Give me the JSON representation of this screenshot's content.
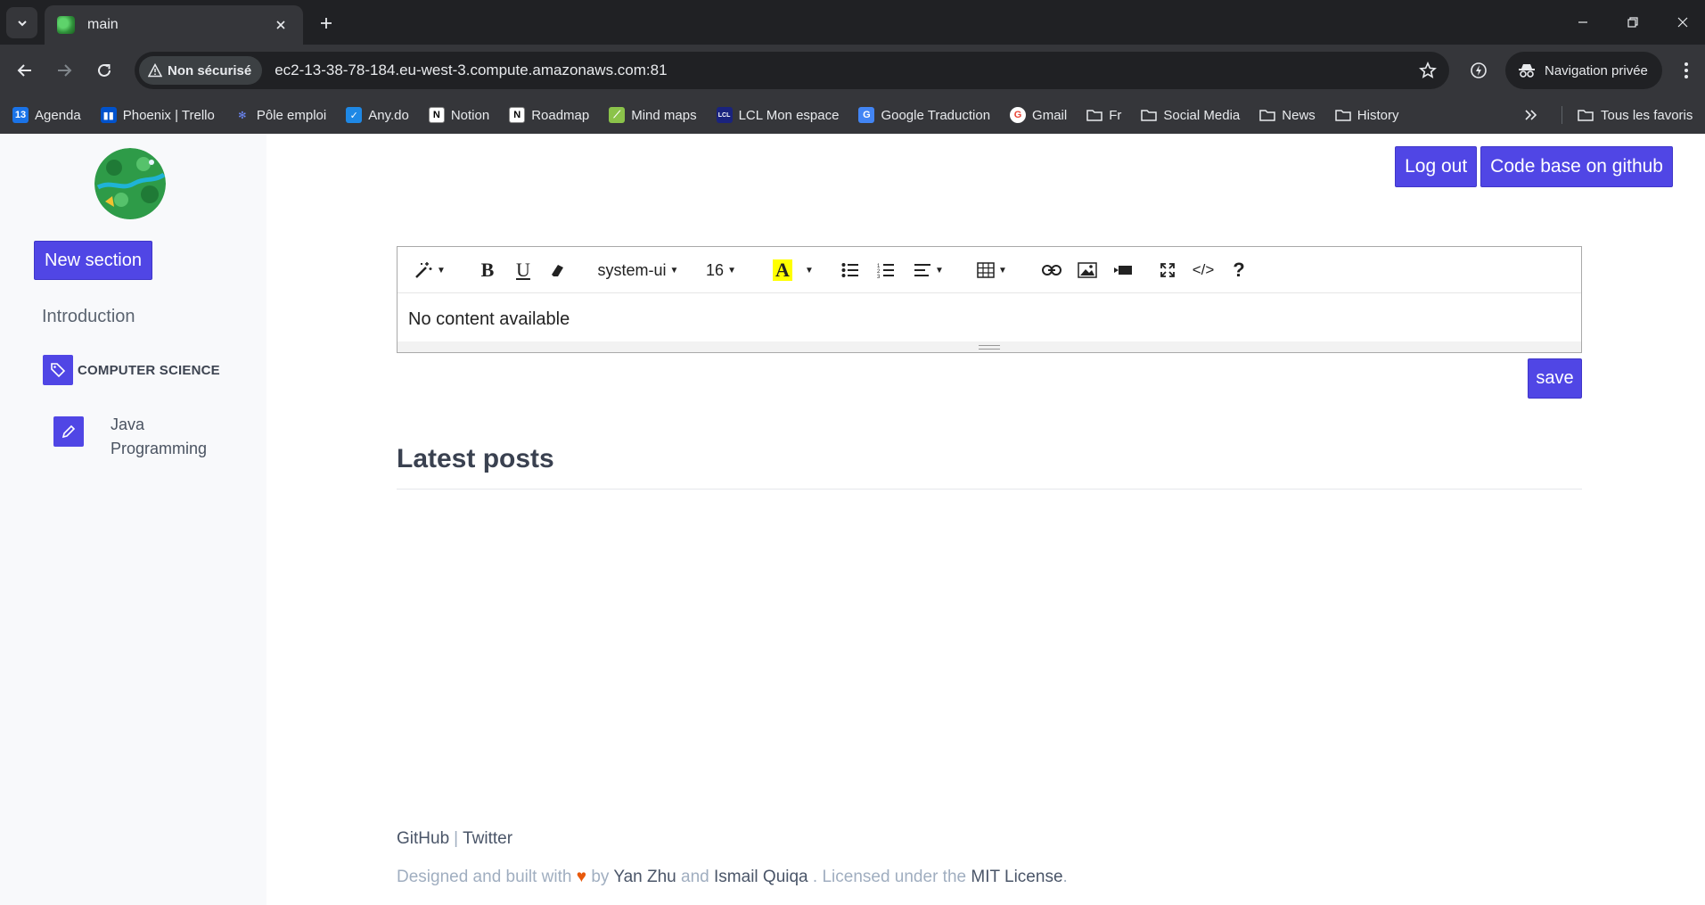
{
  "browser": {
    "tab_title": "main",
    "security_label": "Non sécurisé",
    "url": "ec2-13-38-78-184.eu-west-3.compute.amazonaws.com:81",
    "incognito_label": "Navigation privée",
    "all_bookmarks_label": "Tous les favoris",
    "bookmarks": [
      {
        "label": "Agenda",
        "icon": "calendar-icon",
        "color": "#1a73e8"
      },
      {
        "label": "Phoenix | Trello",
        "icon": "trello-icon",
        "color": "#0052cc"
      },
      {
        "label": "Pôle emploi",
        "icon": "pole-emploi-icon",
        "color": "#3d5afe"
      },
      {
        "label": "Any.do",
        "icon": "anydo-icon",
        "color": "#1e88e5"
      },
      {
        "label": "Notion",
        "icon": "notion-icon",
        "color": "#ffffff"
      },
      {
        "label": "Roadmap",
        "icon": "notion-icon",
        "color": "#ffffff"
      },
      {
        "label": "Mind maps",
        "icon": "mindmap-icon",
        "color": "#8bc34a"
      },
      {
        "label": "LCL Mon espace",
        "icon": "lcl-icon",
        "color": "#1a237e"
      },
      {
        "label": "Google Traduction",
        "icon": "translate-icon",
        "color": "#4285f4"
      },
      {
        "label": "Gmail",
        "icon": "google-icon",
        "color": "#ffffff"
      },
      {
        "label": "Fr",
        "icon": "folder-icon",
        "color": ""
      },
      {
        "label": "Social Media",
        "icon": "folder-icon",
        "color": ""
      },
      {
        "label": "News",
        "icon": "folder-icon",
        "color": ""
      },
      {
        "label": "History",
        "icon": "folder-icon",
        "color": ""
      }
    ]
  },
  "sidebar": {
    "new_section_label": "New section",
    "intro_label": "Introduction",
    "section_label": "COMPUTER SCIENCE",
    "sub_item_label": "Java Programming"
  },
  "header": {
    "logout_label": "Log out",
    "github_label": "Code base on github"
  },
  "editor": {
    "font_family": "system-ui",
    "font_size": "16",
    "content": "No content available",
    "save_label": "save"
  },
  "main": {
    "latest_posts_title": "Latest posts"
  },
  "footer": {
    "github": "GitHub",
    "separator": "|",
    "twitter": "Twitter",
    "designed_prefix": "Designed and built with",
    "heart": "♥",
    "by": "by",
    "author1": "Yan Zhu",
    "and": "and",
    "author2": "Ismail Quiqa",
    "licensed_prefix": ". Licensed under the",
    "license": "MIT License",
    "period": "."
  },
  "colors": {
    "accent": "#5046e5",
    "sidebar_bg": "#f8f9fb",
    "chrome_dark": "#202124",
    "chrome_mid": "#35363a"
  }
}
